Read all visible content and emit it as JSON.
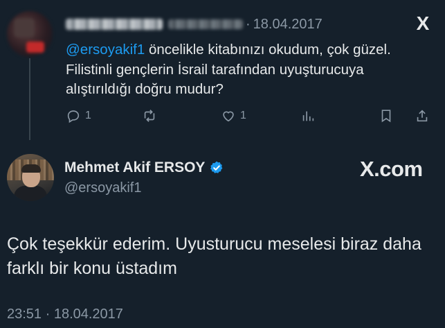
{
  "reply": {
    "author_name_blurred": "",
    "dot": "·",
    "date": "18.04.2017",
    "mention": "@ersoyakif1",
    "text_after_mention": " öncelikle kitabınızı okudum, çok güzel. Filistinli gençlerin İsrail tarafından uyuşturucuya alıştırıldığı doğru mudur?",
    "actions": {
      "reply_count": "1",
      "retweet_count": "",
      "like_count": "1"
    }
  },
  "close_label": "X",
  "main": {
    "author_name": "Mehmet Akif ERSOY",
    "handle": "@ersoyakif1",
    "brand": "X.com",
    "text": "Çok teşekkür ederim. Uyusturucu meselesi biraz daha farklı bir konu üstadım",
    "timestamp": "23:51 · 18.04.2017"
  },
  "colors": {
    "background": "#15202b",
    "text": "#e7e9ea",
    "secondary": "#8b98a5",
    "link": "#1d9bf0",
    "verified": "#1d9bf0"
  }
}
